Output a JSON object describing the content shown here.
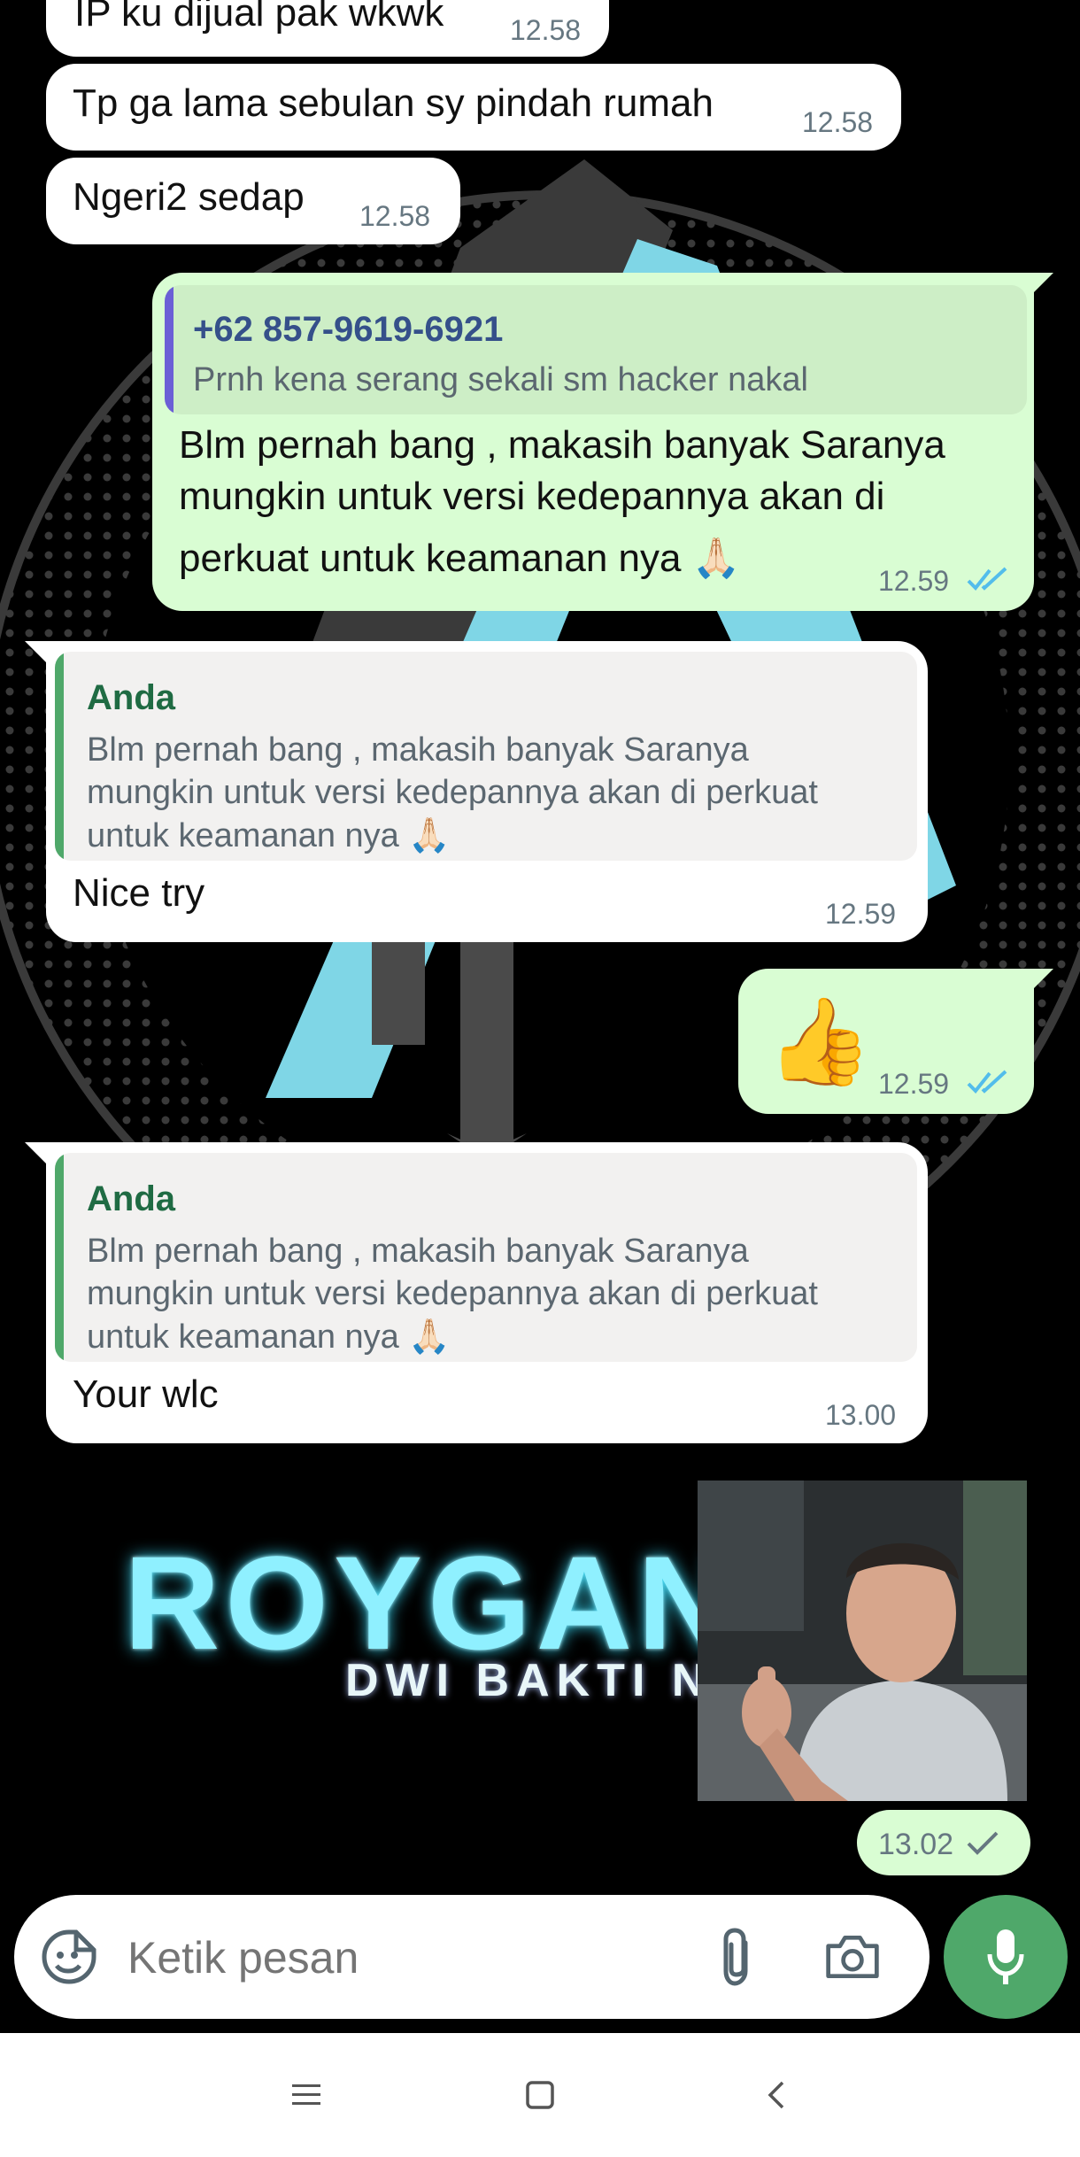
{
  "messages": [
    {
      "text": "IP ku dijual pak wkwk",
      "time": "12.58"
    },
    {
      "text": "Tp ga lama sebulan sy pindah rumah",
      "time": "12.58"
    },
    {
      "text": "Ngeri2 sedap",
      "time": "12.58"
    },
    {
      "quote_name": "+62 857-9619-6921",
      "quote_text": "Prnh kena serang sekali sm hacker nakal",
      "lines": [
        "Blm pernah bang , makasih banyak Saranya",
        "mungkin untuk versi kedepannya akan di",
        "perkuat untuk keamanan nya 🙏🏻"
      ],
      "time": "12.59"
    },
    {
      "quote_name": "Anda",
      "quote_lines": [
        "Blm pernah bang , makasih banyak Saranya",
        "mungkin untuk versi kedepannya akan di perkuat",
        "untuk keamanan nya 🙏🏻"
      ],
      "text": "Nice try",
      "time": "12.59"
    },
    {
      "emoji": "👍",
      "time": "12.59"
    },
    {
      "quote_name": "Anda",
      "quote_lines": [
        "Blm pernah bang , makasih banyak Saranya",
        "mungkin untuk versi kedepannya akan di perkuat",
        "untuk keamanan nya 🙏🏻"
      ],
      "text": "Your wlc",
      "time": "13.00"
    },
    {
      "sticker_title": "ROYGAN",
      "sticker_sub": "DWI BAKTI N",
      "time": "13.02"
    }
  ],
  "composer": {
    "placeholder": "Ketik pesan"
  },
  "icons": {
    "emoji": "sticker-smiley-icon",
    "attach": "paperclip-icon",
    "camera": "camera-icon",
    "mic": "microphone-icon",
    "ticks_read": "double-check-blue-icon",
    "tick_sent": "single-check-icon",
    "nav_menu": "menu-lines-icon",
    "nav_home": "square-home-icon",
    "nav_back": "chevron-left-icon"
  },
  "colors": {
    "incoming": "#ffffff",
    "outgoing": "#d9fdd3",
    "accent_green": "#4fa86a",
    "read_blue": "#53bdeb"
  }
}
